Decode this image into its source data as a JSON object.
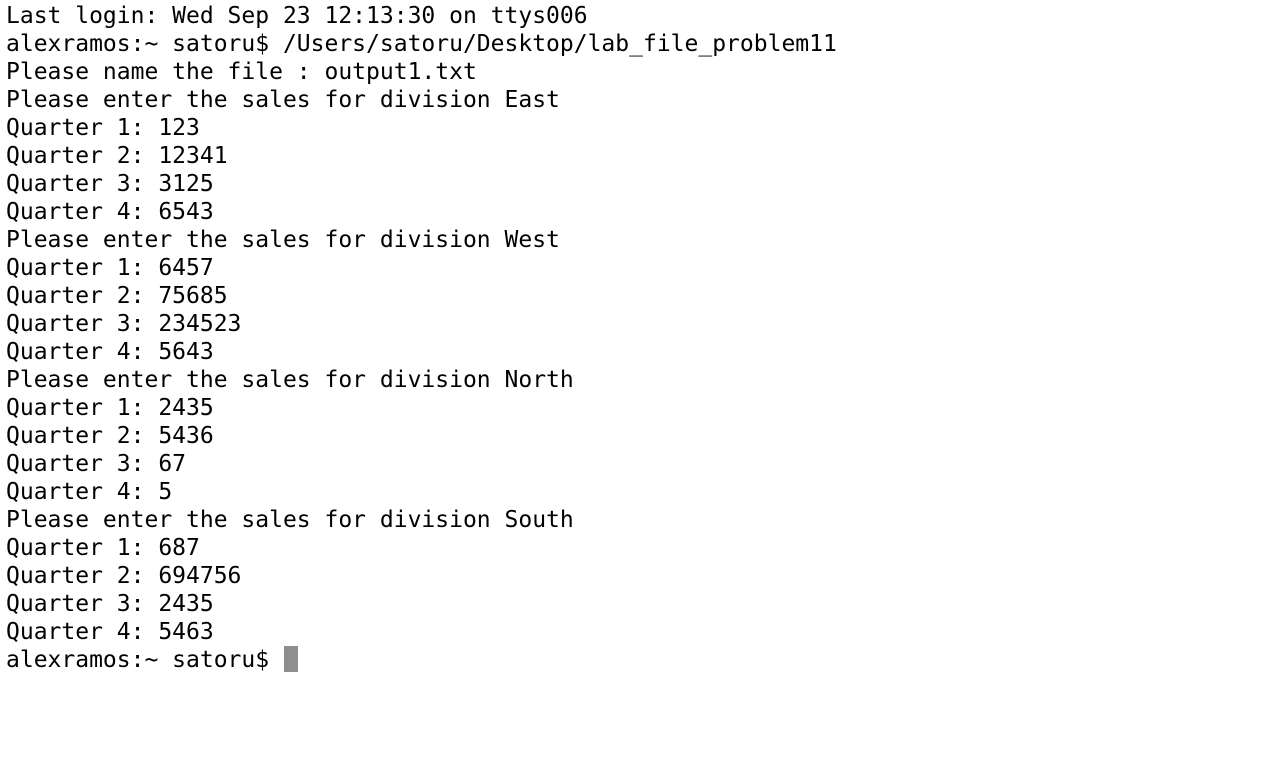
{
  "terminal": {
    "lines": [
      "Last login: Wed Sep 23 12:13:30 on ttys006",
      "alexramos:~ satoru$ /Users/satoru/Desktop/lab_file_problem11",
      "Please name the file : output1.txt",
      "Please enter the sales for division East",
      "Quarter 1: 123",
      "Quarter 2: 12341",
      "Quarter 3: 3125",
      "Quarter 4: 6543",
      "Please enter the sales for division West",
      "Quarter 1: 6457",
      "Quarter 2: 75685",
      "Quarter 3: 234523",
      "Quarter 4: 5643",
      "Please enter the sales for division North",
      "Quarter 1: 2435",
      "Quarter 2: 5436",
      "Quarter 3: 67",
      "Quarter 4: 5",
      "Please enter the sales for division South",
      "Quarter 1: 687",
      "Quarter 2: 694756",
      "Quarter 3: 2435",
      "Quarter 4: 5463"
    ],
    "prompt": "alexramos:~ satoru$ ",
    "colors": {
      "background": "#ffffff",
      "text": "#000000",
      "cursor": "#8e8e8e"
    }
  }
}
